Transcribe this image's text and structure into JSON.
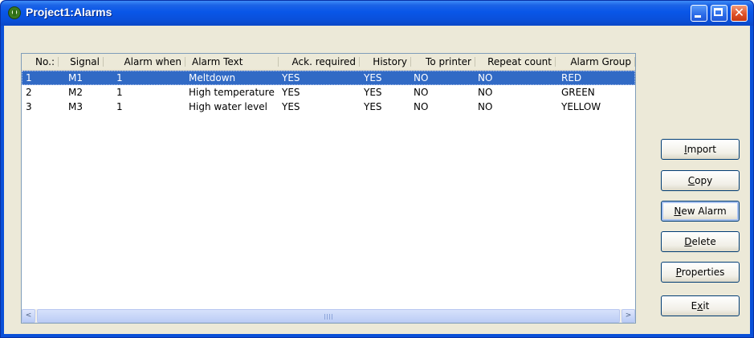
{
  "window": {
    "title": "Project1:Alarms",
    "title_color": "#ffffff",
    "titlebar_color": "#0a50d8"
  },
  "caption_buttons": {
    "minimize_icon": "minimize-icon",
    "maximize_icon": "maximize-icon",
    "close_icon": "close-icon",
    "close_glyph": "✕"
  },
  "table": {
    "columns": [
      "No.:",
      "Signal",
      "Alarm when",
      "Alarm Text",
      "Ack. required",
      "History",
      "To printer",
      "Repeat count",
      "Alarm Group"
    ],
    "rows": [
      [
        "1",
        "M1",
        "1",
        "Meltdown",
        "YES",
        "YES",
        "NO",
        "NO",
        "RED"
      ],
      [
        "2",
        "M2",
        "1",
        "High temperature",
        "YES",
        "YES",
        "NO",
        "NO",
        "GREEN"
      ],
      [
        "3",
        "M3",
        "1",
        "High water level",
        "YES",
        "YES",
        "NO",
        "NO",
        "YELLOW"
      ]
    ],
    "selected_row_index": 0,
    "selection_color": "#316ac5"
  },
  "scrollbar": {
    "left_arrow": "<",
    "right_arrow": ">"
  },
  "buttons": {
    "import": {
      "first": "I",
      "rest": "mport"
    },
    "copy": {
      "first": "C",
      "rest": "opy"
    },
    "new_alarm": {
      "first": "N",
      "rest": "ew Alarm"
    },
    "delete": {
      "first": "D",
      "rest": "elete"
    },
    "properties": {
      "first": "P",
      "rest": "roperties"
    },
    "exit": {
      "pre": "E",
      "first": "x",
      "rest": "it"
    }
  }
}
